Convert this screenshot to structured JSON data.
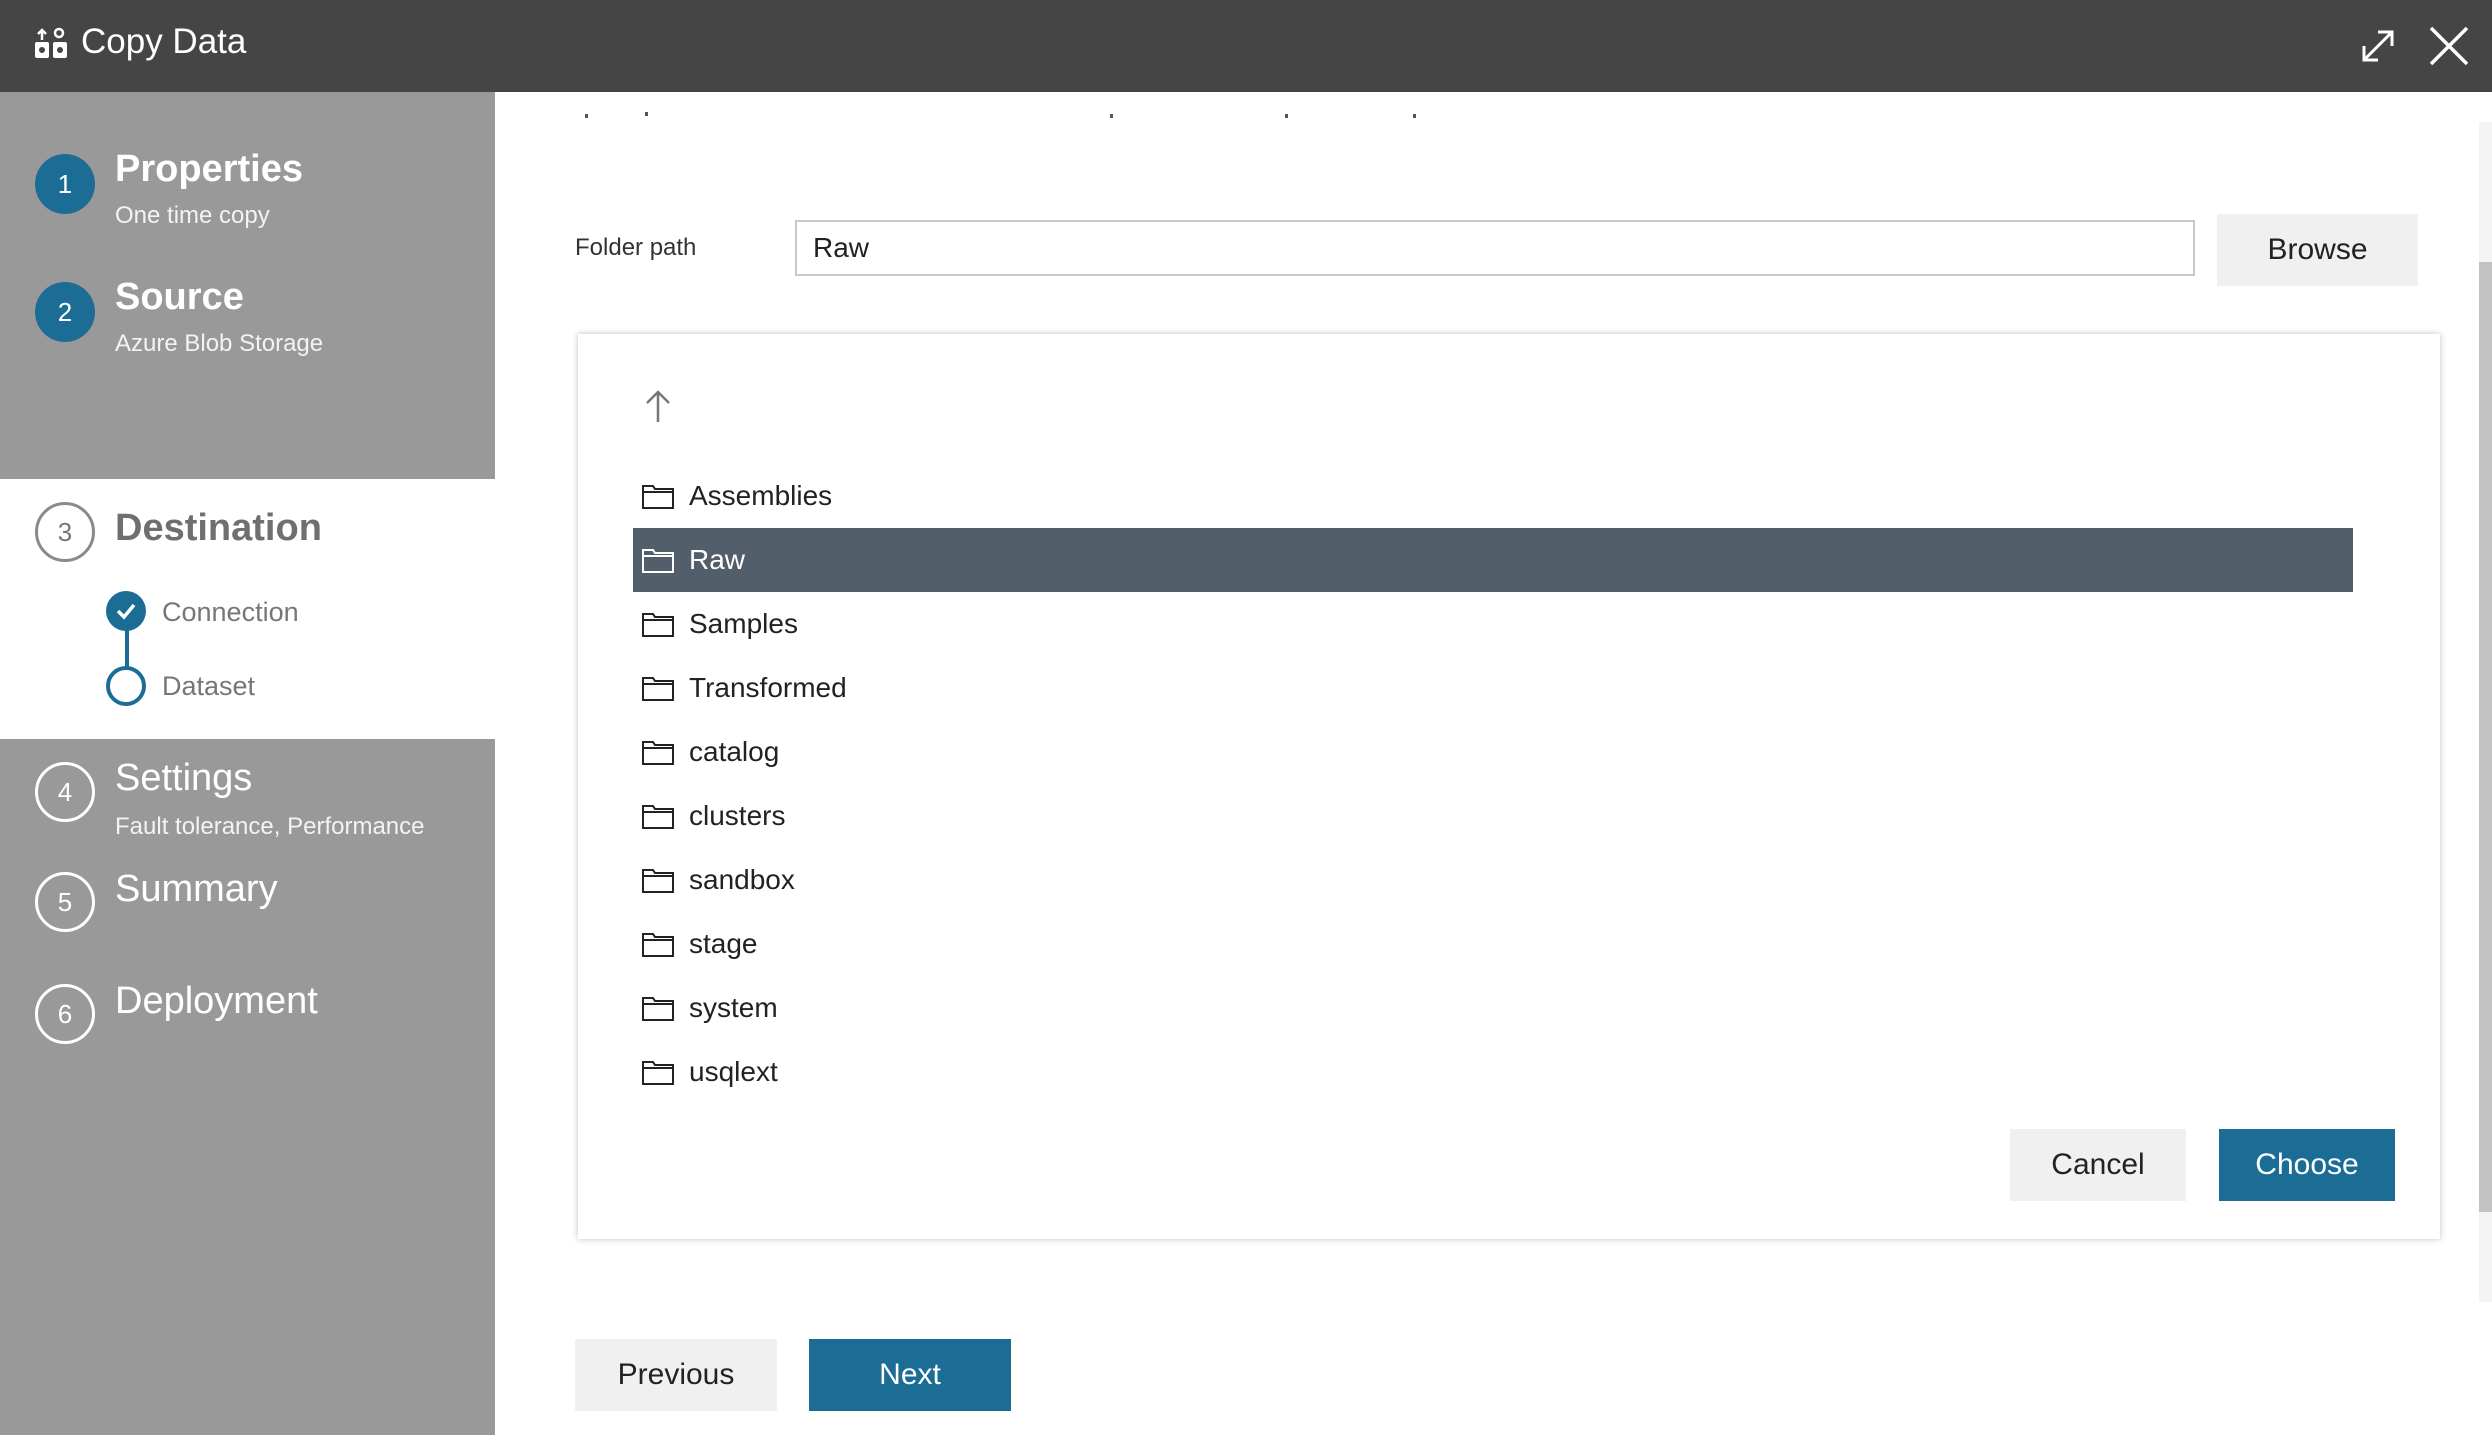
{
  "window": {
    "title": "Copy Data"
  },
  "steps": [
    {
      "number": "1",
      "title": "Properties",
      "subtitle": "One time copy"
    },
    {
      "number": "2",
      "title": "Source",
      "subtitle": "Azure Blob Storage"
    },
    {
      "number": "3",
      "title": "Destination",
      "subtitle": ""
    },
    {
      "number": "4",
      "title": "Settings",
      "subtitle": "Fault tolerance, Performance"
    },
    {
      "number": "5",
      "title": "Summary",
      "subtitle": ""
    },
    {
      "number": "6",
      "title": "Deployment",
      "subtitle": ""
    }
  ],
  "substeps": [
    {
      "label": "Connection",
      "completed": true
    },
    {
      "label": "Dataset",
      "completed": false
    }
  ],
  "folder_path": {
    "label": "Folder path",
    "value": "Raw",
    "browse_label": "Browse"
  },
  "folders": [
    {
      "name": "Assemblies"
    },
    {
      "name": "Raw"
    },
    {
      "name": "Samples"
    },
    {
      "name": "Transformed"
    },
    {
      "name": "catalog"
    },
    {
      "name": "clusters"
    },
    {
      "name": "sandbox"
    },
    {
      "name": "stage"
    },
    {
      "name": "system"
    },
    {
      "name": "usqlext"
    }
  ],
  "selected_folder": "Raw",
  "dialog": {
    "cancel_label": "Cancel",
    "choose_label": "Choose"
  },
  "nav": {
    "previous_label": "Previous",
    "next_label": "Next"
  },
  "colors": {
    "accent": "#1b6d96",
    "titlebar": "#454545",
    "sidebar": "#999999",
    "selected_row": "#535e6b"
  }
}
